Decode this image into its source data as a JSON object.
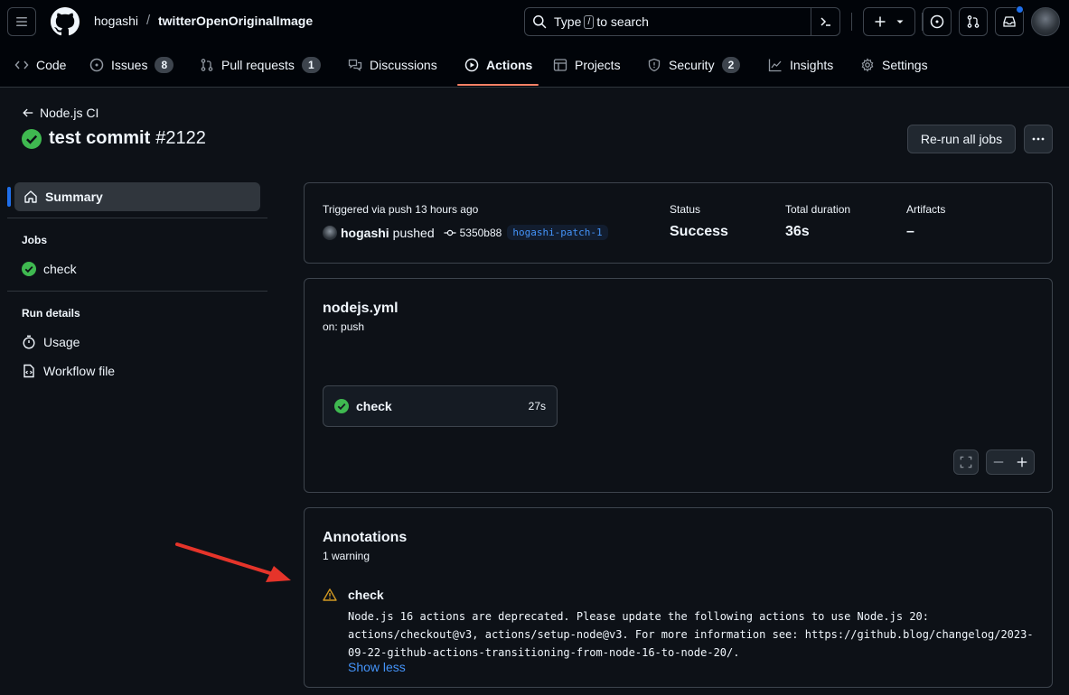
{
  "repo": {
    "owner": "hogashi",
    "separator": "/",
    "name": "twitterOpenOriginalImage"
  },
  "search": {
    "prefix": "Type",
    "key": "/",
    "suffix": "to search"
  },
  "tabs": [
    {
      "label": "Code",
      "icon": "code-icon"
    },
    {
      "label": "Issues",
      "icon": "issue-opened-icon",
      "count": "8"
    },
    {
      "label": "Pull requests",
      "icon": "git-pull-request-icon",
      "count": "1"
    },
    {
      "label": "Discussions",
      "icon": "comment-discussion-icon"
    },
    {
      "label": "Actions",
      "icon": "play-icon",
      "active": true
    },
    {
      "label": "Projects",
      "icon": "table-icon"
    },
    {
      "label": "Security",
      "icon": "shield-icon",
      "count": "2"
    },
    {
      "label": "Insights",
      "icon": "graph-icon"
    },
    {
      "label": "Settings",
      "icon": "gear-icon"
    }
  ],
  "run": {
    "workflow_link": "Node.js CI",
    "title": "test commit",
    "number": "#2122",
    "rerun_label": "Re-run all jobs"
  },
  "sidebar": {
    "summary": "Summary",
    "jobs_heading": "Jobs",
    "jobs": [
      {
        "label": "check",
        "status": "success"
      }
    ],
    "run_details_heading": "Run details",
    "details": [
      {
        "label": "Usage",
        "icon": "stopwatch-icon"
      },
      {
        "label": "Workflow file",
        "icon": "file-icon"
      }
    ]
  },
  "summary_box": {
    "triggered": "Triggered via push 13 hours ago",
    "pusher": "hogashi",
    "pushed": "pushed",
    "sha": "5350b88",
    "branch": "hogashi-patch-1",
    "status_label": "Status",
    "status_value": "Success",
    "duration_label": "Total duration",
    "duration_value": "36s",
    "artifacts_label": "Artifacts",
    "artifacts_value": "–"
  },
  "workflow": {
    "file": "nodejs.yml",
    "on": "on: push",
    "job": {
      "name": "check",
      "duration": "27s"
    }
  },
  "annotations": {
    "title": "Annotations",
    "count": "1 warning",
    "job": "check",
    "message": "Node.js 16 actions are deprecated. Please update the following actions to use Node.js 20:\nactions/checkout@v3, actions/setup-node@v3. For more information see: https://github.blog/changelog/2023-\n09-22-github-actions-transitioning-from-node-16-to-node-20/.",
    "toggle": "Show less"
  },
  "colors": {
    "success": "#3fb950",
    "accent": "#4493f8",
    "warning": "#d29922",
    "active_tab": "#f78166",
    "arrow": "#e5342a"
  }
}
